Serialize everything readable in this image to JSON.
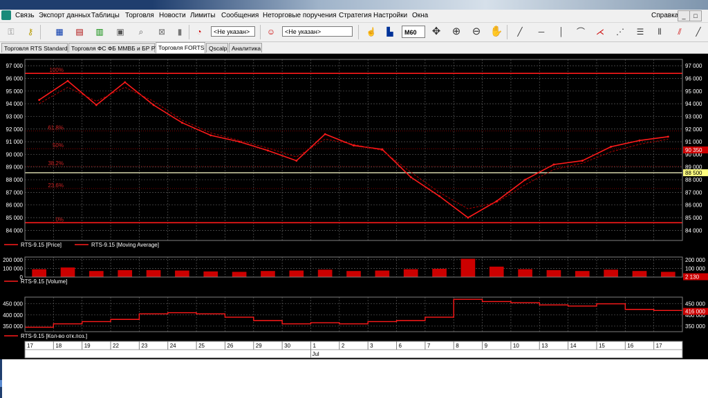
{
  "menu": {
    "items": [
      "Связь",
      "Экспорт данных",
      "Таблицы",
      "Торговля",
      "Новости",
      "Лимиты",
      "Сообщения",
      "Неторговые поручения",
      "Стратегия",
      "Настройки",
      "Окна"
    ],
    "help": "Справка",
    "window_controls": [
      "_",
      "□",
      "×"
    ]
  },
  "toolbar": {
    "account_placeholder": "<Не указан>",
    "client_placeholder": "<Не указан>",
    "interval": "M60"
  },
  "tabs": [
    "Торговля RTS Standard",
    "Торговля ФС ФБ ММВБ и БР РТС",
    "Торговля FORTS",
    "Qscalp",
    "Аналитика"
  ],
  "active_tab": 2,
  "price_panel": {
    "y_ticks": [
      84000,
      85000,
      86000,
      87000,
      88000,
      89000,
      90000,
      91000,
      92000,
      93000,
      94000,
      95000,
      96000,
      97000
    ],
    "y_tick_labels": [
      "84 000",
      "85 000",
      "86 000",
      "87 000",
      "88 000",
      "89 000",
      "90 000",
      "91 000",
      "92 000",
      "93 000",
      "94 000",
      "95 000",
      "96 000",
      "97 000"
    ],
    "ylim": [
      83200,
      97500
    ],
    "fib_levels": [
      {
        "label": "100%",
        "value": 96400
      },
      {
        "label": "61.8%",
        "value": 91850
      },
      {
        "label": "50%",
        "value": 90450
      },
      {
        "label": "38.2%",
        "value": 89050
      },
      {
        "label": "23.6%",
        "value": 87300
      },
      {
        "label": "0%",
        "value": 84600
      }
    ],
    "horizontal_lines": [
      96400,
      88550,
      84600
    ],
    "current_price_label": "90 350",
    "current_price": 90350,
    "horizontal_level_label": "88 500",
    "horizontal_level": 88550,
    "legend": [
      {
        "label": "RTS-9.15 [Price]",
        "color": "#ff1a1a"
      },
      {
        "label": "RTS-9.15 [Moving Average]",
        "color": "#ff1a1a"
      }
    ]
  },
  "volume_panel": {
    "y_tick_labels": [
      "200 000",
      "100 000",
      "0"
    ],
    "y_ticks": [
      200000,
      100000,
      0
    ],
    "ylim": [
      0,
      230000
    ],
    "current_label": "2 130",
    "legend": "RTS-9.15 [Volume]"
  },
  "oi_panel": {
    "y_tick_labels": [
      "450 000",
      "400 000",
      "350 000"
    ],
    "y_ticks": [
      450000,
      400000,
      350000
    ],
    "ylim": [
      325000,
      480000
    ],
    "current_label": "416 000",
    "legend": "RTS-9.15 [Кол-во отк.поз.]"
  },
  "time_axis": {
    "days": [
      "17",
      "18",
      "19",
      "22",
      "23",
      "24",
      "25",
      "26",
      "29",
      "30",
      "1",
      "2",
      "3",
      "6",
      "7",
      "8",
      "9",
      "10",
      "13",
      "14",
      "15",
      "16",
      "17"
    ],
    "month_label": "Jul"
  },
  "colors": {
    "background": "#000000",
    "series": "#ff1a1a",
    "grid": "#5a5a5a",
    "highlight": "#ffff80"
  },
  "chart_data": [
    {
      "type": "line",
      "title": "RTS-9.15 [Price]",
      "x": [
        "17",
        "18",
        "19",
        "22",
        "23",
        "24",
        "25",
        "26",
        "29",
        "30",
        "1",
        "2",
        "3",
        "6",
        "7",
        "8",
        "9",
        "10",
        "13",
        "14",
        "15",
        "16",
        "17"
      ],
      "series": [
        {
          "name": "RTS-9.15 [Price]",
          "values": [
            94300,
            95800,
            93900,
            95700,
            93900,
            92500,
            91500,
            91000,
            90300,
            89500,
            91600,
            90700,
            90400,
            88200,
            86700,
            85000,
            86300,
            88000,
            89200,
            89500,
            90600,
            91100,
            91400
          ]
        },
        {
          "name": "RTS-9.15 [Moving Average]",
          "values": [
            94000,
            95300,
            94200,
            95300,
            94200,
            92700,
            91700,
            91100,
            90500,
            89800,
            91200,
            90800,
            90300,
            88600,
            87000,
            85700,
            86200,
            87600,
            88800,
            89300,
            90200,
            90800,
            91200
          ]
        }
      ],
      "ylim": [
        83200,
        97500
      ]
    },
    {
      "type": "bar",
      "title": "RTS-9.15 [Volume]",
      "x": [
        "17",
        "18",
        "19",
        "22",
        "23",
        "24",
        "25",
        "26",
        "29",
        "30",
        "1",
        "2",
        "3",
        "6",
        "7",
        "8",
        "9",
        "10",
        "13",
        "14",
        "15",
        "16",
        "17"
      ],
      "values": [
        90000,
        110000,
        70000,
        80000,
        80000,
        75000,
        65000,
        60000,
        70000,
        75000,
        85000,
        70000,
        75000,
        90000,
        95000,
        210000,
        120000,
        90000,
        80000,
        70000,
        85000,
        70000,
        60000
      ],
      "ylim": [
        0,
        230000
      ]
    },
    {
      "type": "line",
      "title": "RTS-9.15 [Кол-во отк.поз.]",
      "x": [
        "17",
        "18",
        "19",
        "22",
        "23",
        "24",
        "25",
        "26",
        "29",
        "30",
        "1",
        "2",
        "3",
        "6",
        "7",
        "8",
        "9",
        "10",
        "13",
        "14",
        "15",
        "16",
        "17"
      ],
      "values": [
        345000,
        360000,
        370000,
        380000,
        405000,
        410000,
        405000,
        390000,
        375000,
        360000,
        365000,
        360000,
        370000,
        375000,
        390000,
        470000,
        460000,
        455000,
        445000,
        440000,
        450000,
        425000,
        420000
      ],
      "ylim": [
        325000,
        480000
      ]
    }
  ]
}
